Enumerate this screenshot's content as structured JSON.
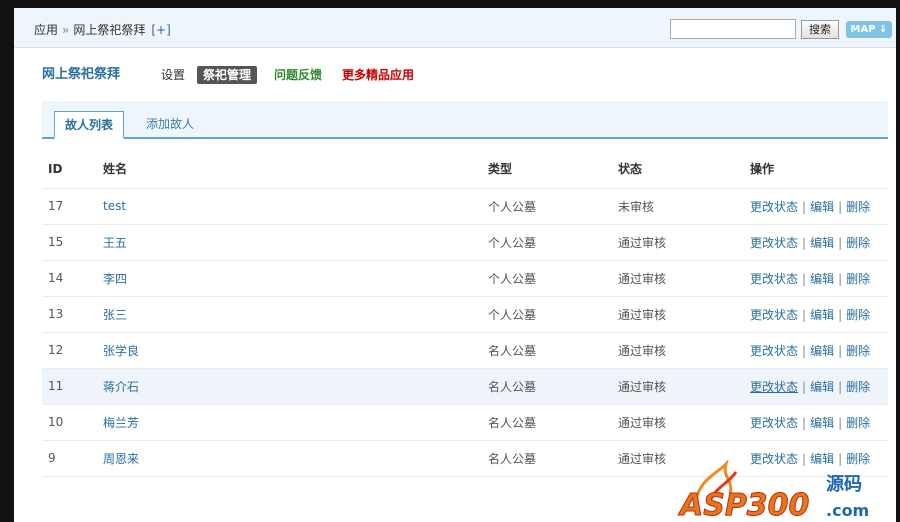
{
  "breadcrumb": {
    "root": "应用",
    "separator": "»",
    "current": "网上祭祀祭拜",
    "add": "[+]"
  },
  "search": {
    "placeholder": "",
    "button_label": "搜索"
  },
  "map_button_label": "MAP ⇓",
  "app_nav": {
    "title": "网上祭祀祭拜",
    "settings": "设置",
    "manage": "祭祀管理",
    "feedback": "问题反馈",
    "more": "更多精品应用"
  },
  "tabs": [
    {
      "label": "故人列表",
      "active": true
    },
    {
      "label": "添加故人",
      "active": false
    }
  ],
  "table": {
    "headers": [
      "ID",
      "姓名",
      "类型",
      "状态",
      "操作"
    ],
    "rows": [
      {
        "id": "17",
        "name": "test",
        "type": "个人公墓",
        "status": "未审核",
        "status_kind": "pending"
      },
      {
        "id": "15",
        "name": "王五",
        "type": "个人公墓",
        "status": "通过审核",
        "status_kind": "ok"
      },
      {
        "id": "14",
        "name": "李四",
        "type": "个人公墓",
        "status": "通过审核",
        "status_kind": "ok"
      },
      {
        "id": "13",
        "name": "张三",
        "type": "个人公墓",
        "status": "通过审核",
        "status_kind": "ok"
      },
      {
        "id": "12",
        "name": "张学良",
        "type": "名人公墓",
        "status": "通过审核",
        "status_kind": "ok"
      },
      {
        "id": "11",
        "name": "蒋介石",
        "type": "名人公墓",
        "status": "通过审核",
        "status_kind": "ok",
        "highlighted": true
      },
      {
        "id": "10",
        "name": "梅兰芳",
        "type": "名人公墓",
        "status": "通过审核",
        "status_kind": "ok"
      },
      {
        "id": "9",
        "name": "周恩来",
        "type": "名人公墓",
        "status": "通过审核",
        "status_kind": "ok"
      }
    ],
    "actions": {
      "change_status": "更改状态",
      "separator": "|",
      "edit": "编辑",
      "delete": "删除"
    }
  },
  "watermark": {
    "logo": "ASP300",
    "text": "源码",
    "domain": ".com"
  },
  "colors": {
    "accent": "#2a6f9e",
    "pending": "#d40000",
    "ok": "#2f9a2f",
    "tab_border": "#5aa6cf"
  }
}
